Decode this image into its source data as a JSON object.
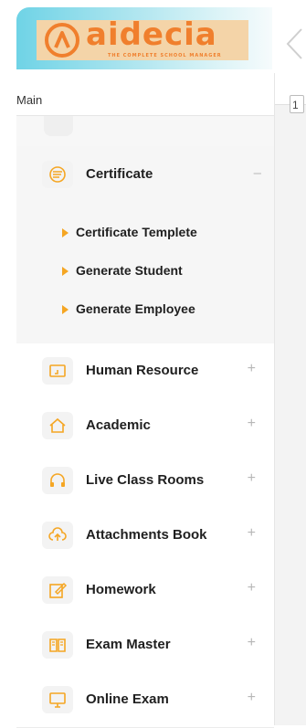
{
  "brand": {
    "name": "aidecia",
    "tagline": "THE COMPLETE SCHOOL MANAGER",
    "accent_color": "#f07f2d",
    "icon_color": "#f5a623"
  },
  "sidebar": {
    "section_label": "Main",
    "expanded": {
      "label": "Certificate",
      "icon": "certificate-icon",
      "toggle": "–",
      "children": [
        {
          "label": "Certificate Templete"
        },
        {
          "label": "Generate Student"
        },
        {
          "label": "Generate Employee"
        }
      ]
    },
    "items": [
      {
        "label": "Human Resource",
        "icon": "hr-icon",
        "toggle": "+"
      },
      {
        "label": "Academic",
        "icon": "home-icon",
        "toggle": "+"
      },
      {
        "label": "Live Class Rooms",
        "icon": "headphones-icon",
        "toggle": "+"
      },
      {
        "label": "Attachments Book",
        "icon": "cloud-upload-icon",
        "toggle": "+"
      },
      {
        "label": "Homework",
        "icon": "edit-icon",
        "toggle": "+"
      },
      {
        "label": "Exam Master",
        "icon": "book-icon",
        "toggle": "+"
      },
      {
        "label": "Online Exam",
        "icon": "monitor-icon",
        "toggle": "+"
      }
    ]
  },
  "content": {
    "mini_value": "1"
  }
}
